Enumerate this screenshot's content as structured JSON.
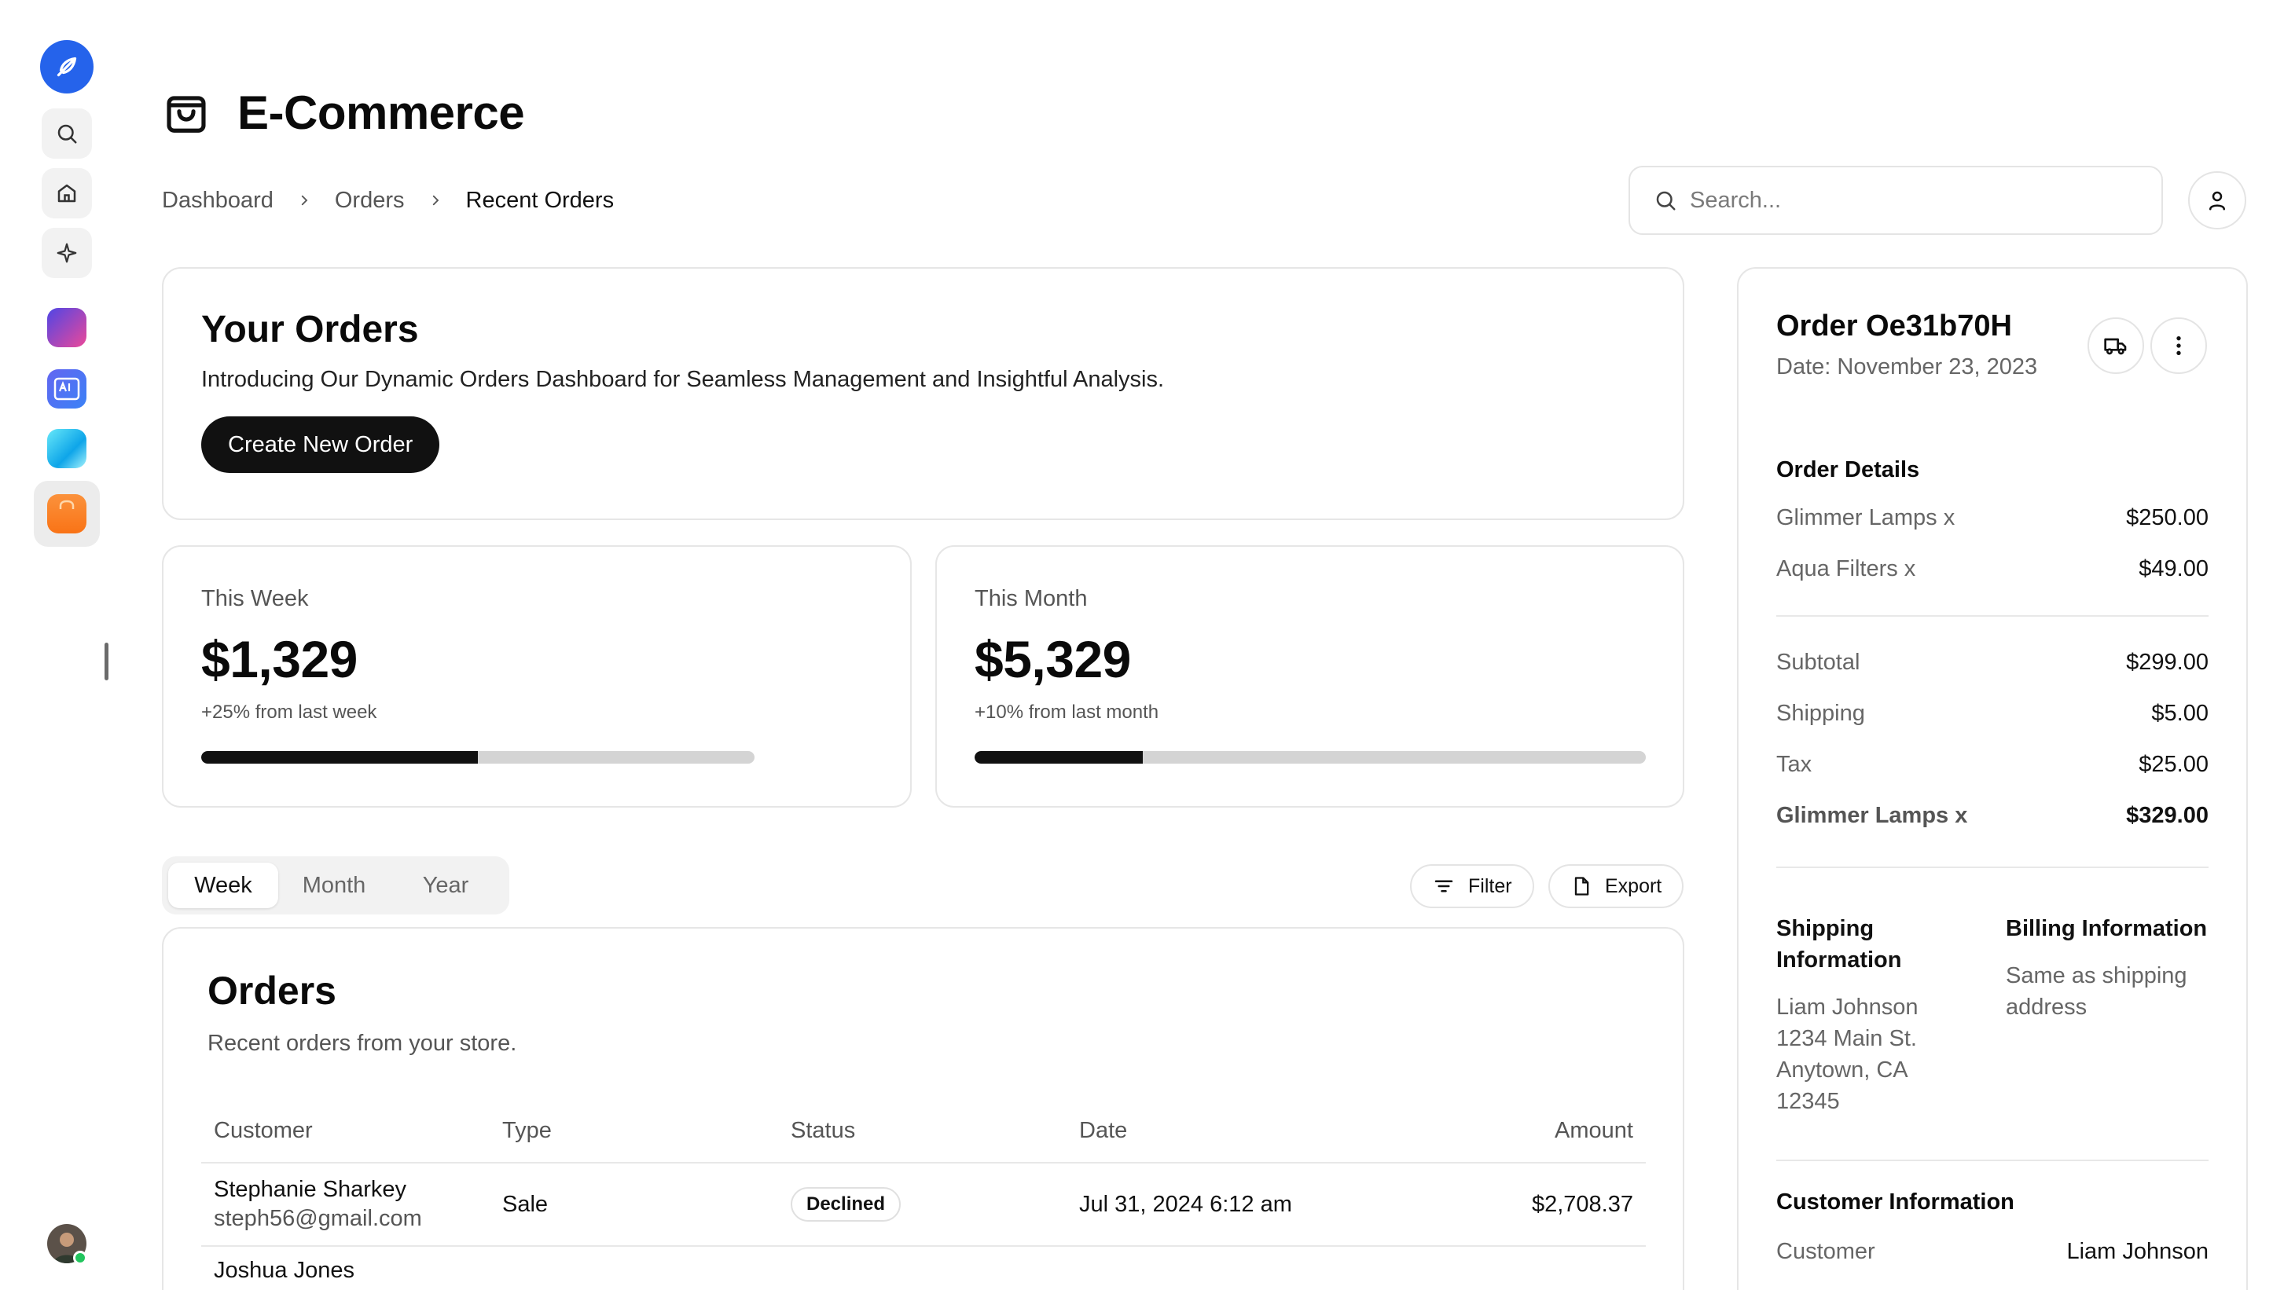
{
  "header": {
    "title": "E-Commerce",
    "title_icon": "shopping-bag-icon"
  },
  "breadcrumb": [
    "Dashboard",
    "Orders",
    "Recent Orders"
  ],
  "search": {
    "placeholder": "Search..."
  },
  "hero": {
    "title": "Your Orders",
    "description": "Introducing Our Dynamic Orders Dashboard for Seamless Management and Insightful Analysis.",
    "button_label": "Create New Order"
  },
  "stats": [
    {
      "label": "This Week",
      "value": "$1,329",
      "change": "+25% from last week",
      "progress": 0.5
    },
    {
      "label": "This Month",
      "value": "$5,329",
      "change": "+10% from last month",
      "progress": 0.25
    }
  ],
  "period_tabs": [
    {
      "label": "Week",
      "active": true
    },
    {
      "label": "Month",
      "active": false
    },
    {
      "label": "Year",
      "active": false
    }
  ],
  "toolbar": {
    "filter_label": "Filter",
    "export_label": "Export"
  },
  "orders": {
    "title": "Orders",
    "description": "Recent orders from your store.",
    "columns": [
      "Customer",
      "Type",
      "Status",
      "Date",
      "Amount"
    ],
    "rows": [
      {
        "name": "Stephanie Sharkey",
        "email": "steph56@gmail.com",
        "type": "Sale",
        "status": "Declined",
        "date": "Jul 31, 2024 6:12 am",
        "amount": "$2,708.37"
      },
      {
        "name": "Joshua Jones",
        "email": "",
        "type": "",
        "status": "",
        "date": "",
        "amount": ""
      }
    ]
  },
  "order_panel": {
    "title": "Order Oe31b70H",
    "date": "Date: November 23, 2023",
    "details_title": "Order Details",
    "items": [
      {
        "label": "Glimmer Lamps x",
        "value": "$250.00"
      },
      {
        "label": "Aqua Filters x",
        "value": "$49.00"
      }
    ],
    "totals": [
      {
        "label": "Subtotal",
        "value": "$299.00"
      },
      {
        "label": "Shipping",
        "value": "$5.00"
      },
      {
        "label": "Tax",
        "value": "$25.00"
      }
    ],
    "grand_total": {
      "label": "Glimmer Lamps x",
      "value": "$329.00"
    },
    "shipping": {
      "title": "Shipping Information",
      "lines": [
        "Liam Johnson",
        "1234 Main St.",
        "Anytown, CA",
        "12345"
      ]
    },
    "billing": {
      "title": "Billing Information",
      "text": "Same as shipping address"
    },
    "customer": {
      "title": "Customer Information",
      "label": "Customer",
      "value": "Liam Johnson"
    }
  },
  "colors": {
    "accent": "#2563eb",
    "dark": "#111111",
    "online": "#22c55e"
  }
}
